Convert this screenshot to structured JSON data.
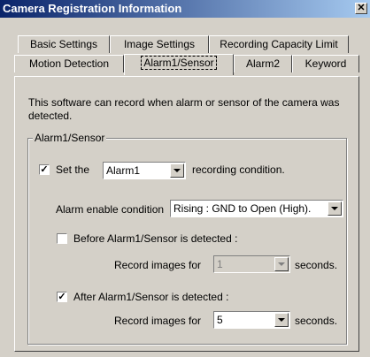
{
  "window": {
    "title": "Camera Registration Information",
    "close_glyph": "✕"
  },
  "tabs": {
    "row_back": [
      "Basic Settings",
      "Image Settings",
      "Recording Capacity Limit"
    ],
    "row_front": [
      "Motion Detection",
      "Alarm1/Sensor",
      "Alarm2",
      "Keyword"
    ],
    "active": "Alarm1/Sensor"
  },
  "content": {
    "description": "This software can record when alarm or sensor of the camera was detected.",
    "group_label": "Alarm1/Sensor",
    "set_the": {
      "checked": true,
      "check_glyph": "✓",
      "prefix": "Set the",
      "combo_value": "Alarm1",
      "suffix": "recording condition."
    },
    "alarm_enable": {
      "label": "Alarm enable condition",
      "value": "Rising : GND to Open (High)."
    },
    "before": {
      "checked": false,
      "label": "Before Alarm1/Sensor is detected :",
      "record_label": "Record images for",
      "value": "1",
      "unit": "seconds."
    },
    "after": {
      "checked": true,
      "check_glyph": "✓",
      "label": "After Alarm1/Sensor is detected :",
      "record_label": "Record images for",
      "value": "5",
      "unit": "seconds."
    }
  }
}
